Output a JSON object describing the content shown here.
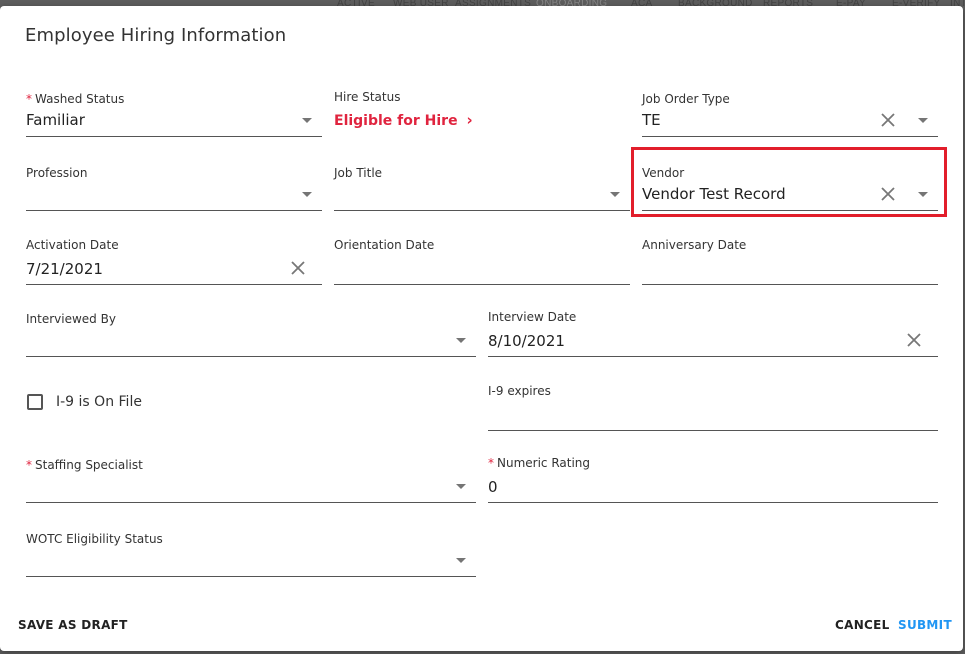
{
  "background_nav": [
    "ACTIVE",
    "WEB USER",
    "ASSIGNMENTS",
    "ONBOARDING",
    "ACA",
    "BACKGROUND",
    "REPORTS",
    "E-PAY",
    "E-VERIFY",
    "INT"
  ],
  "dialog": {
    "title": "Employee Hiring Information",
    "fields": {
      "washed_status": {
        "label": "Washed Status",
        "required": "*",
        "value": "Familiar"
      },
      "hire_status": {
        "label": "Hire Status",
        "value": "Eligible for Hire",
        "chevron": "›"
      },
      "job_order_type": {
        "label": "Job Order Type",
        "value": "TE"
      },
      "profession": {
        "label": "Profession",
        "value": ""
      },
      "job_title": {
        "label": "Job Title",
        "value": ""
      },
      "vendor": {
        "label": "Vendor",
        "value": "Vendor Test Record"
      },
      "activation_date": {
        "label": "Activation Date",
        "value": "7/21/2021"
      },
      "orientation_date": {
        "label": "Orientation Date",
        "value": ""
      },
      "anniversary_date": {
        "label": "Anniversary Date",
        "value": ""
      },
      "interviewed_by": {
        "label": "Interviewed By",
        "value": ""
      },
      "interview_date": {
        "label": "Interview Date",
        "value": "8/10/2021"
      },
      "i9_on_file": {
        "label": "I-9 is On File",
        "checked": false
      },
      "i9_expires": {
        "label": "I-9 expires",
        "value": ""
      },
      "staffing_specialist": {
        "label": "Staffing Specialist",
        "required": "*",
        "value": ""
      },
      "numeric_rating": {
        "label": "Numeric Rating",
        "required": "*",
        "value": "0"
      },
      "wotc_status": {
        "label": "WOTC Eligibility Status",
        "value": ""
      }
    },
    "footer": {
      "save_draft": "SAVE AS DRAFT",
      "cancel": "CANCEL",
      "submit": "SUBMIT"
    }
  },
  "colors": {
    "accent_blue": "#2196f3",
    "required_red": "#e0243f",
    "highlight_red": "#e21e2b"
  }
}
